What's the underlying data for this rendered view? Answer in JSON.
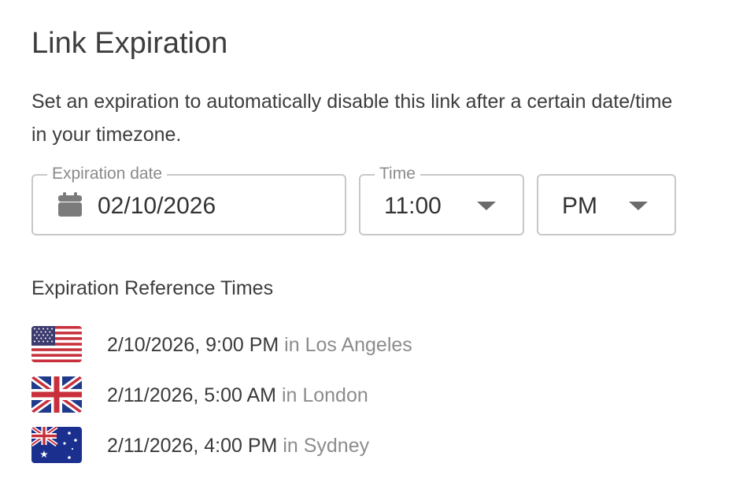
{
  "title": "Link Expiration",
  "description": "Set an expiration to automatically disable this link after a certain date/time in your timezone.",
  "expiration_date": {
    "label": "Expiration date",
    "value": "02/10/2026",
    "icon": "calendar-icon"
  },
  "time": {
    "label": "Time",
    "value": "11:00",
    "icon": "chevron-down-icon"
  },
  "ampm": {
    "value": "PM",
    "icon": "chevron-down-icon"
  },
  "reference": {
    "heading": "Expiration Reference Times",
    "rows": [
      {
        "flag": "us-flag-icon",
        "time": "2/10/2026, 9:00 PM",
        "city": "in Los Angeles"
      },
      {
        "flag": "uk-flag-icon",
        "time": "2/11/2026, 5:00 AM",
        "city": "in London"
      },
      {
        "flag": "au-flag-icon",
        "time": "2/11/2026, 4:00 PM",
        "city": "in Sydney"
      }
    ]
  },
  "colors": {
    "border": "#c8c8c8",
    "muted_text": "#8c8c8c",
    "text": "#3d3d3d"
  }
}
